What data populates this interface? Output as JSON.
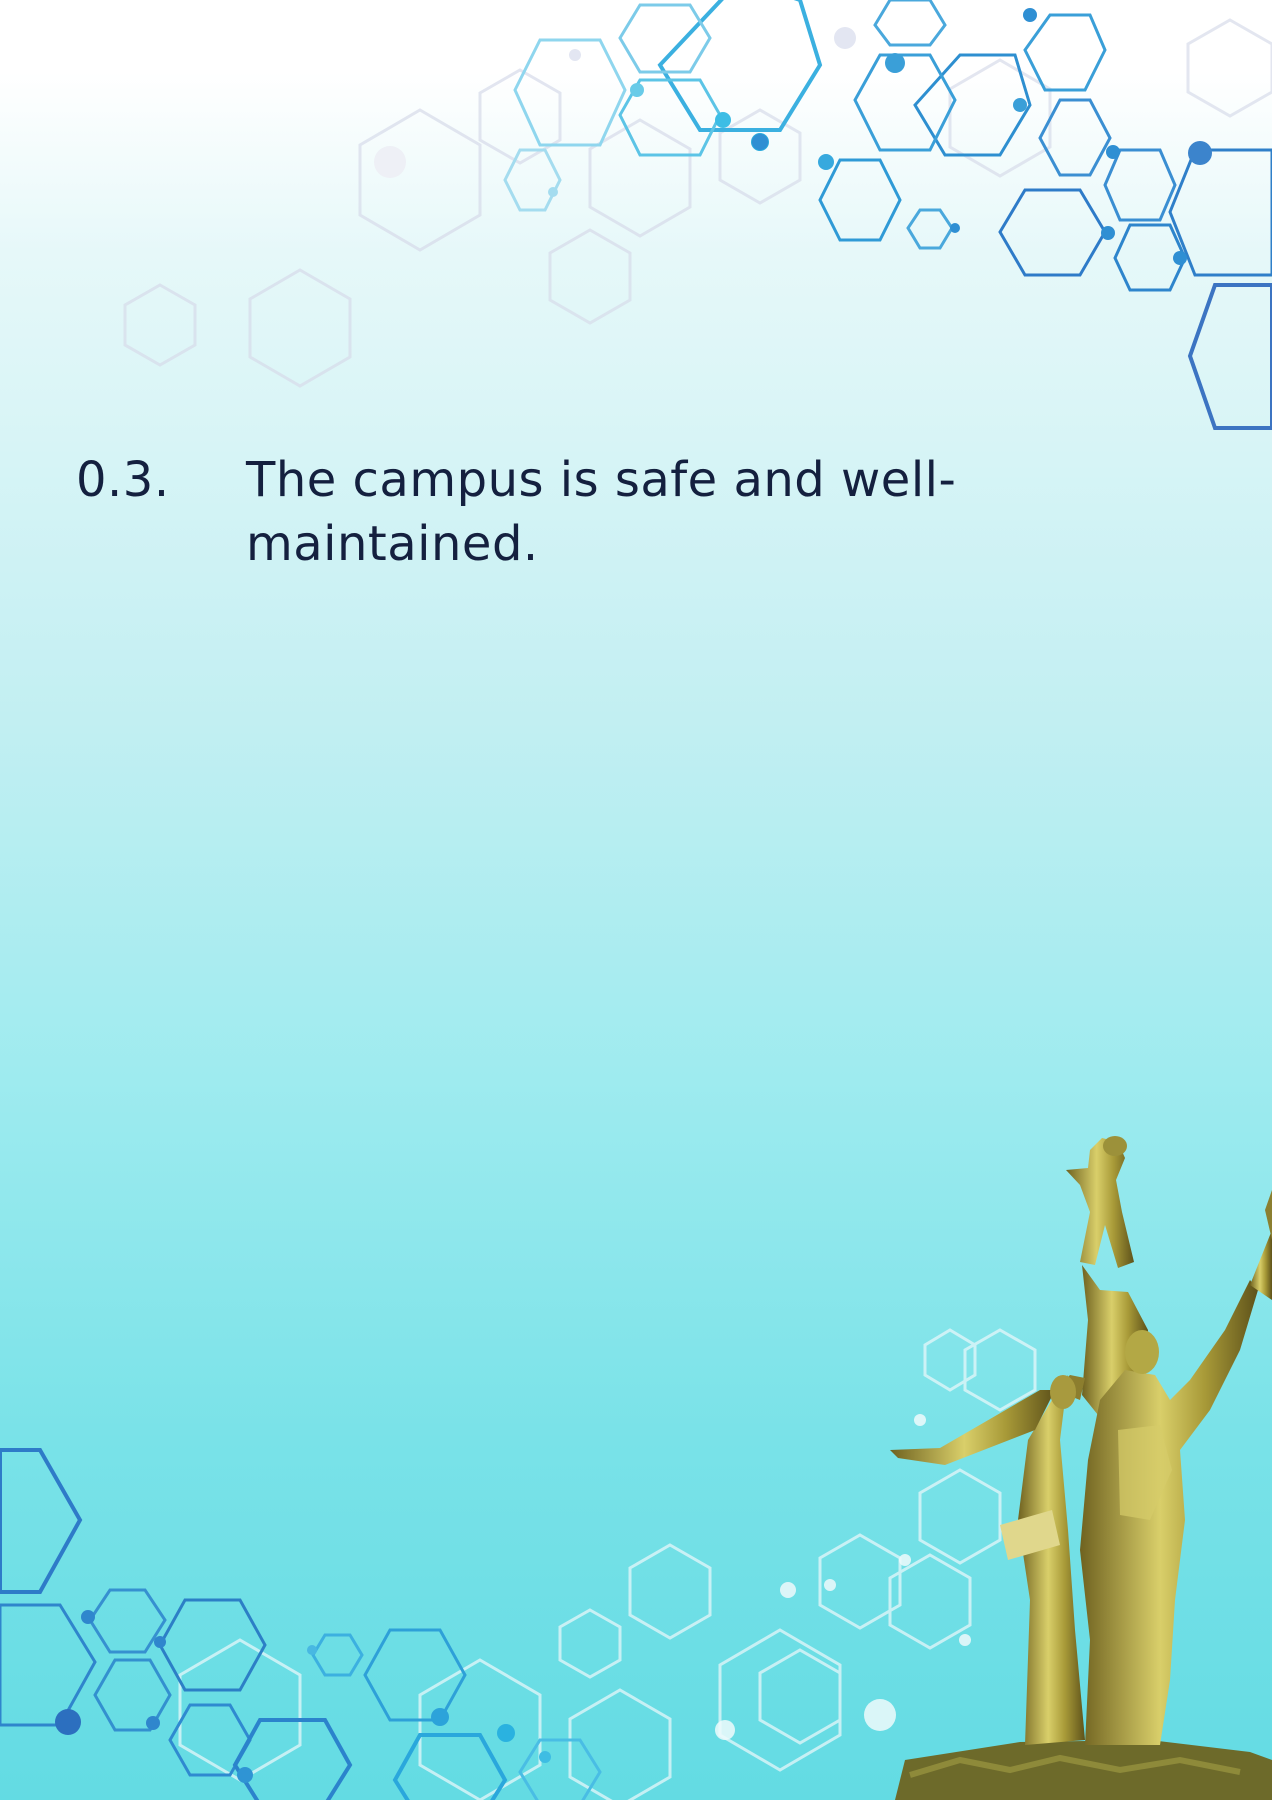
{
  "question": {
    "number": "0.3.",
    "text": "The campus is safe and well- maintained."
  },
  "colors": {
    "text": "#14203f",
    "hex_primary": "#2a9fd8",
    "hex_dark": "#2d6fba",
    "hex_light": "#ffffff"
  },
  "images": {
    "statue": "golden-monument-statue"
  }
}
